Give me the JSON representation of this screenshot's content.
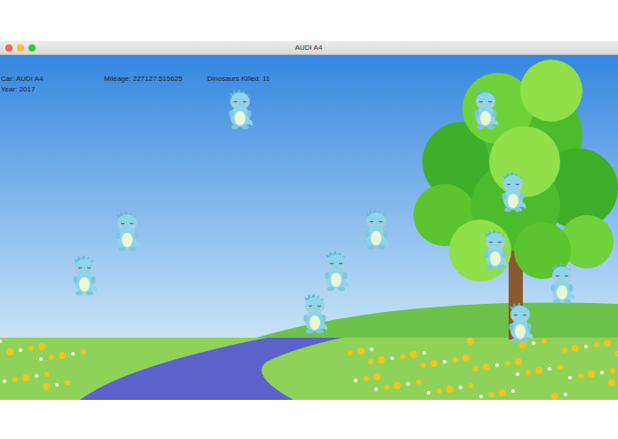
{
  "window": {
    "title": "AUDI A4"
  },
  "hud": {
    "car": "Car: AUDI A4",
    "year": "Year: 2017",
    "mileage": "Mileage: 227127.515625",
    "kills": "Dinosaurs Killed: 11"
  },
  "sprites": [
    {
      "kind": "dinosaur"
    },
    {
      "kind": "dinosaur"
    },
    {
      "kind": "dinosaur"
    },
    {
      "kind": "dinosaur"
    },
    {
      "kind": "dinosaur"
    },
    {
      "kind": "dinosaur"
    },
    {
      "kind": "dinosaur"
    },
    {
      "kind": "dinosaur"
    },
    {
      "kind": "dinosaur"
    },
    {
      "kind": "dinosaur"
    },
    {
      "kind": "dinosaur"
    }
  ]
}
